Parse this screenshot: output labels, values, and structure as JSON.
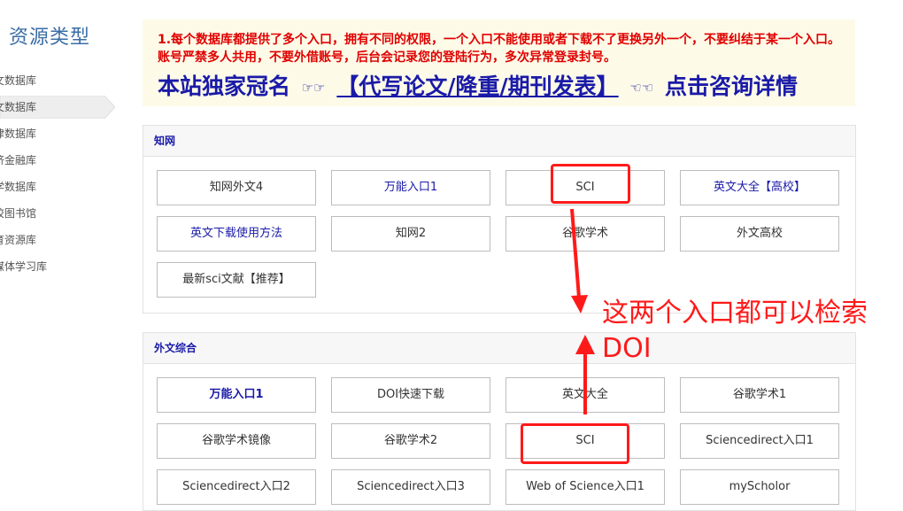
{
  "sidebar": {
    "title": "资源类型",
    "items": [
      {
        "label": "文数据库",
        "active": false
      },
      {
        "label": "文数据库",
        "active": true
      },
      {
        "label": "律数据库",
        "active": false
      },
      {
        "label": "济金融库",
        "active": false
      },
      {
        "label": "学数据库",
        "active": false
      },
      {
        "label": "校图书馆",
        "active": false
      },
      {
        "label": "育资源库",
        "active": false
      },
      {
        "label": "媒体学习库",
        "active": false
      }
    ]
  },
  "notice": {
    "text": "1.每个数据库都提供了多个入口，拥有不同的权限，一个入口不能使用或者下载不了更换另外一个，不要纠结于某一个入口。账号严禁多人共用，不要外借账号，后台会记录您的登陆行为，多次异常登录封号。",
    "promo_prefix": "本站独家冠名",
    "hand_right": "☞☞",
    "promo_link": "【代写论文/降重/期刊发表】",
    "hand_left": "☜☜",
    "promo_suffix": "点击咨询详情"
  },
  "panels": [
    {
      "title": "知网",
      "buttons": [
        {
          "label": "知网外文4",
          "style": "plain"
        },
        {
          "label": "万能入口1",
          "style": "blue"
        },
        {
          "label": "SCI",
          "style": "plain"
        },
        {
          "label": "英文大全【高校】",
          "style": "blue"
        },
        {
          "label": "英文下载使用方法",
          "style": "blue"
        },
        {
          "label": "知网2",
          "style": "plain"
        },
        {
          "label": "谷歌学术",
          "style": "plain"
        },
        {
          "label": "外文高校",
          "style": "plain"
        },
        {
          "label": "最新sci文献【推荐】",
          "style": "plain"
        }
      ]
    },
    {
      "title": "外文综合",
      "buttons": [
        {
          "label": "万能入口1",
          "style": "bold-blue"
        },
        {
          "label": "DOI快速下载",
          "style": "plain"
        },
        {
          "label": "英文大全",
          "style": "plain"
        },
        {
          "label": "谷歌学术1",
          "style": "plain"
        },
        {
          "label": "谷歌学术镜像",
          "style": "plain"
        },
        {
          "label": "谷歌学术2",
          "style": "plain"
        },
        {
          "label": "SCI",
          "style": "plain"
        },
        {
          "label": "Sciencedirect入口1",
          "style": "plain"
        },
        {
          "label": "Sciencedirect入口2",
          "style": "plain"
        },
        {
          "label": "Sciencedirect入口3",
          "style": "plain"
        },
        {
          "label": "Web of Science入口1",
          "style": "plain"
        },
        {
          "label": "myScholor",
          "style": "plain"
        }
      ]
    }
  ],
  "annotation": {
    "line1": "这两个入口都可以检索",
    "line2": "DOI"
  },
  "colors": {
    "notice_red": "#e00000",
    "link_blue": "#1a1aa8",
    "annotation_red": "#ff1a1a",
    "sidebar_title": "#3a6ea5"
  }
}
